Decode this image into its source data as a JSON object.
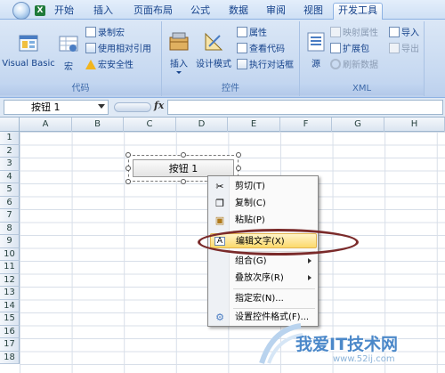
{
  "tabs": [
    {
      "label": "开始",
      "active": false
    },
    {
      "label": "插入",
      "active": false
    },
    {
      "label": "页面布局",
      "active": false
    },
    {
      "label": "公式",
      "active": false
    },
    {
      "label": "数据",
      "active": false
    },
    {
      "label": "审阅",
      "active": false
    },
    {
      "label": "视图",
      "active": false
    },
    {
      "label": "开发工具",
      "active": true
    }
  ],
  "ribbon": {
    "code": {
      "label": "代码",
      "visual_basic": "Visual Basic",
      "macro": "宏",
      "record_macro": "录制宏",
      "relative_ref": "使用相对引用",
      "macro_security": "宏安全性"
    },
    "controls": {
      "label": "控件",
      "insert": "插入",
      "design_mode": "设计模式",
      "properties": "属性",
      "view_code": "查看代码",
      "run_dialog": "执行对话框"
    },
    "xml": {
      "label": "XML",
      "source": "源",
      "map_properties": "映射属性",
      "expansion_pack": "扩展包",
      "refresh_data": "刷新数据",
      "import": "导入",
      "export": "导出"
    }
  },
  "formula_bar": {
    "name_box": "按钮 1",
    "fx": "fx",
    "formula": ""
  },
  "columns": [
    "A",
    "B",
    "C",
    "D",
    "E",
    "F",
    "G",
    "H"
  ],
  "rows": [
    "1",
    "2",
    "3",
    "4",
    "5",
    "6",
    "7",
    "8",
    "9",
    "10",
    "11",
    "12",
    "13",
    "14",
    "15",
    "16",
    "17",
    "18"
  ],
  "form_button": {
    "label": "按钮 1"
  },
  "context_menu": {
    "items": [
      {
        "label": "剪切(T)",
        "icon": "scissors-icon"
      },
      {
        "label": "复制(C)",
        "icon": "copy-icon"
      },
      {
        "label": "粘贴(P)",
        "icon": "paste-icon"
      },
      {
        "label": "编辑文字(X)",
        "icon": "edit-text-icon",
        "highlighted": true
      },
      {
        "label": "组合(G)",
        "submenu": true
      },
      {
        "label": "叠放次序(R)",
        "submenu": true
      },
      {
        "label": "指定宏(N)..."
      },
      {
        "label": "设置控件格式(F)...",
        "icon": "format-control-icon"
      }
    ]
  },
  "watermark": {
    "text": "我爱IT技术网",
    "sub": "www.52ij.com"
  },
  "colors": {
    "ribbon": "#c7d9f1",
    "highlight": "#fcd96b",
    "oval": "#7a2a2a"
  }
}
